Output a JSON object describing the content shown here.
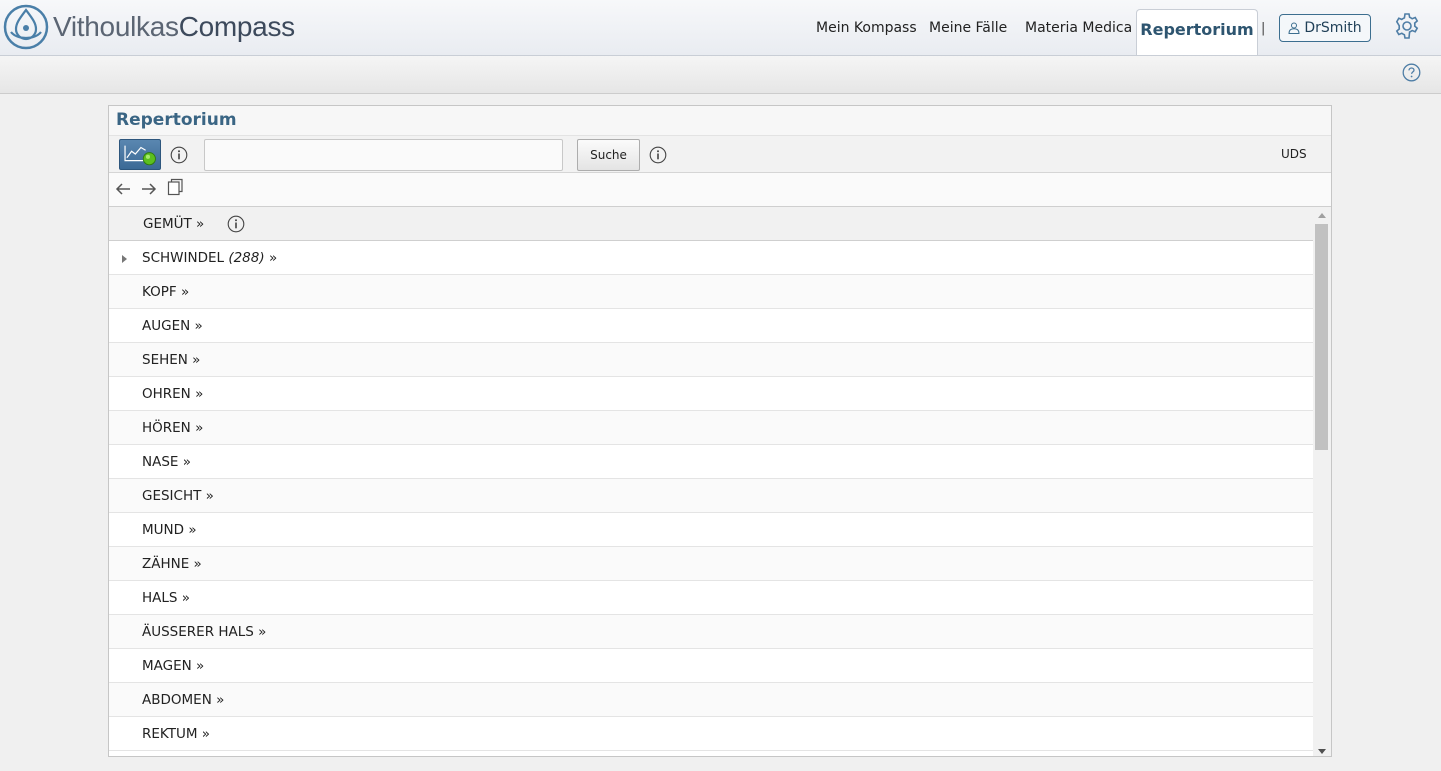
{
  "header": {
    "logo_light": "Vithoulkas",
    "logo_bold": "Compass",
    "nav": [
      "Mein Kompass",
      "Meine Fälle",
      "Materia Medica"
    ],
    "active_tab": "Repertorium",
    "separator": "|",
    "user": "DrSmith"
  },
  "panel": {
    "title": "Repertorium",
    "search_placeholder": "",
    "search_button": "Suche",
    "uds_label": "UDS"
  },
  "list": {
    "header": "GEMÜT »",
    "rows": [
      {
        "label": "SCHWINDEL",
        "count": "(288)",
        "suffix": "»"
      },
      {
        "label": "KOPF »"
      },
      {
        "label": "AUGEN »"
      },
      {
        "label": "SEHEN »"
      },
      {
        "label": "OHREN »"
      },
      {
        "label": "HÖREN »"
      },
      {
        "label": "NASE »"
      },
      {
        "label": "GESICHT »"
      },
      {
        "label": "MUND »"
      },
      {
        "label": "ZÄHNE »"
      },
      {
        "label": "HALS »"
      },
      {
        "label": "ÄUSSERER HALS »"
      },
      {
        "label": "MAGEN »"
      },
      {
        "label": "ABDOMEN »"
      },
      {
        "label": "REKTUM »"
      }
    ]
  },
  "colors": {
    "accent": "#2e5570",
    "title": "#3a6584",
    "button_blue": "#3b6a96"
  }
}
